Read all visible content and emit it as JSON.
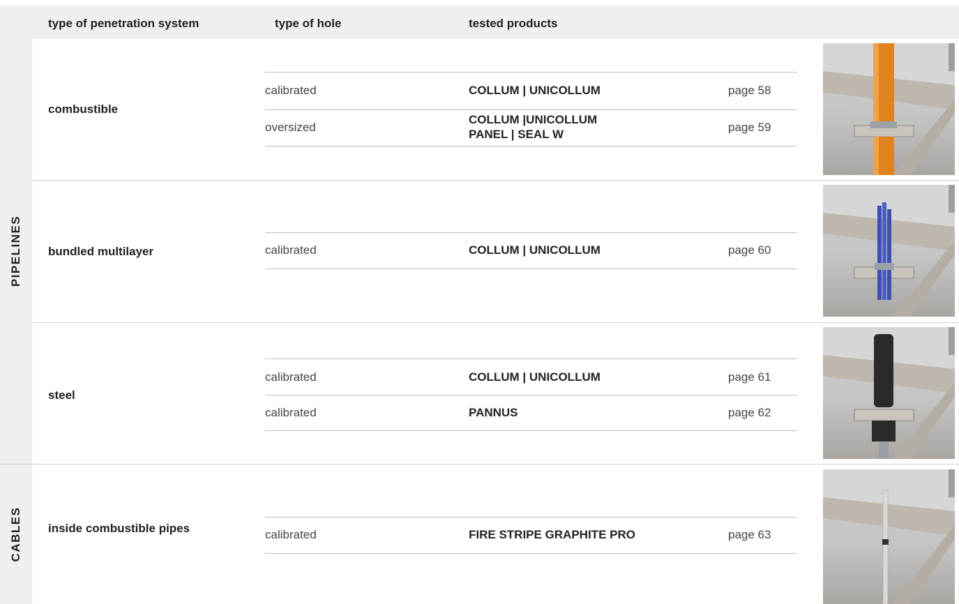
{
  "header": {
    "system": "type of penetration system",
    "hole": "type of hole",
    "products": "tested products"
  },
  "categories": {
    "pipelines": "PIPELINES",
    "cables": "CABLES"
  },
  "sections": [
    {
      "system": "combustible",
      "rows": [
        {
          "hole": "calibrated",
          "product": "COLLUM | UNICOLLUM",
          "page": "page 58"
        },
        {
          "hole": "oversized",
          "product_line1": "COLLUM |UNICOLLUM",
          "product_line2": "PANEL | SEAL W",
          "page": "page 59"
        }
      ],
      "pipe_color": "#e0831f"
    },
    {
      "system": "bundled multilayer",
      "rows": [
        {
          "hole": "calibrated",
          "product": "COLLUM | UNICOLLUM",
          "page": "page 60"
        }
      ],
      "pipe_color": "#3d4fb0"
    },
    {
      "system": "steel",
      "rows": [
        {
          "hole": "calibrated",
          "product": "COLLUM | UNICOLLUM",
          "page": "page 61"
        },
        {
          "hole": "calibrated",
          "product": "PANNUS",
          "page": "page 62"
        }
      ],
      "pipe_color": "#2a2a2a"
    },
    {
      "system": "inside combustible pipes",
      "rows": [
        {
          "hole": "calibrated",
          "product": "FIRE STRIPE GRAPHITE PRO",
          "page": "page 63"
        }
      ],
      "pipe_color": "#d9d9d9"
    }
  ]
}
